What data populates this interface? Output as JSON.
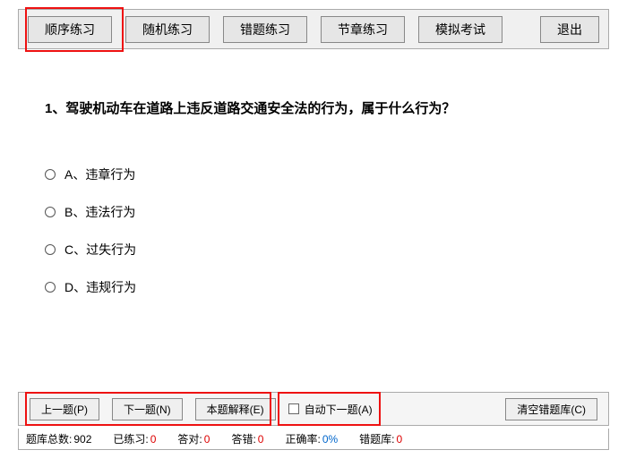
{
  "tabs": {
    "sequential": "顺序练习",
    "random": "随机练习",
    "wrong": "错题练习",
    "chapter": "节章练习",
    "mock": "模拟考试",
    "exit": "退出"
  },
  "question": {
    "text": "1、驾驶机动车在道路上违反道路交通安全法的行为，属于什么行为？",
    "options": {
      "a": "A、违章行为",
      "b": "B、违法行为",
      "c": "C、过失行为",
      "d": "D、违规行为"
    }
  },
  "actions": {
    "prev": "上一题(P)",
    "next": "下一题(N)",
    "explain": "本题解释(E)",
    "auto_next": "自动下一题(A)",
    "clear_wrong": "清空错题库(C)"
  },
  "stats": {
    "total_label": "题库总数:",
    "total_val": "902",
    "done_label": "已练习:",
    "done_val": "0",
    "right_label": "答对:",
    "right_val": "0",
    "wrong_label": "答错:",
    "wrong_val": "0",
    "rate_label": "正确率:",
    "rate_val": "0%",
    "wronglib_label": "错题库:",
    "wronglib_val": "0"
  }
}
